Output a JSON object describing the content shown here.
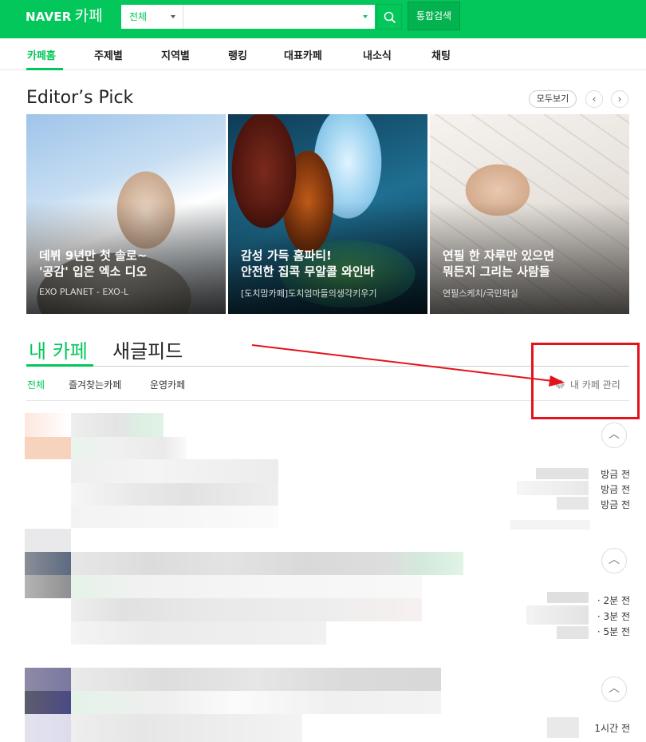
{
  "header": {
    "logo_naver": "NAVER",
    "logo_cafe": "카페",
    "search_scope": "전체",
    "search_value": "",
    "search_button": "통합검색"
  },
  "nav": {
    "items": [
      "카페홈",
      "주제별",
      "지역별",
      "랭킹",
      "대표카페",
      "내소식",
      "채팅"
    ]
  },
  "editors_pick": {
    "title": "Editor’s Pick",
    "more": "모두보기",
    "prev": "‹",
    "next": "›",
    "cards": [
      {
        "title": "데뷔 9년만 첫 솔로~\n'공감' 입은 엑소 디오",
        "cafe": "EXO PLANET - EXO-L"
      },
      {
        "title": "감성 가득 홈파티!\n안전한 집콕 무알콜 와인바",
        "cafe": "[도치맘카페]도치엄마들의생각키우기"
      },
      {
        "title": "연필 한 자루만 있으면\n뭐든지 그리는 사람들",
        "cafe": "연필스케치/국민화실"
      }
    ]
  },
  "mycafe": {
    "tabs": [
      "내 카페",
      "새글피드"
    ],
    "filters": [
      "전체",
      "즐겨찾는카페",
      "운영카페"
    ],
    "manage": "내 카페 관리",
    "groups": [
      {
        "times": [
          "방금 전",
          "방금 전",
          "방금 전"
        ]
      },
      {
        "times": [
          "· 2분 전",
          "· 3분 전",
          "· 5분 전"
        ]
      },
      {
        "times": [
          "1시간 전"
        ]
      }
    ]
  },
  "colors": {
    "brand": "#03c75a",
    "annotation": "#e3121b"
  }
}
